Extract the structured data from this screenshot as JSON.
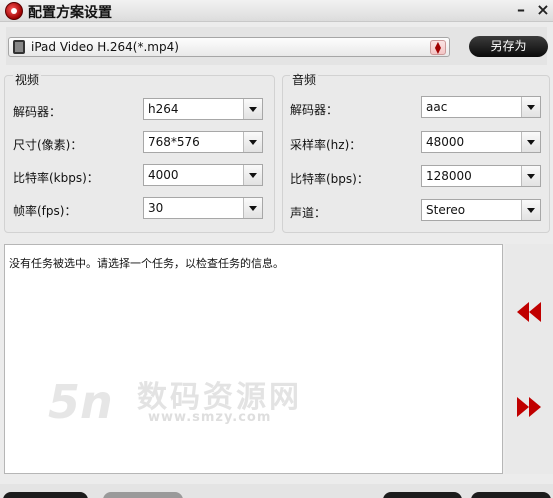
{
  "window": {
    "title": "配置方案设置",
    "minimize_label": "–",
    "close_label": "×"
  },
  "profile": {
    "selected": "iPad Video H.264(*.mp4)",
    "save_as_label": "另存为"
  },
  "video": {
    "group_title": "视频",
    "fields": [
      {
        "label": "解码器：",
        "value": "h264"
      },
      {
        "label": "尺寸(像素)：",
        "value": "768*576"
      },
      {
        "label": "比特率(kbps)：",
        "value": "4000"
      },
      {
        "label": "帧率(fps)：",
        "value": "30"
      }
    ]
  },
  "audio": {
    "group_title": "音频",
    "fields": [
      {
        "label": "解码器：",
        "value": "aac"
      },
      {
        "label": "采样率(hz)：",
        "value": "48000"
      },
      {
        "label": "比特率(bps)：",
        "value": "128000"
      },
      {
        "label": "声道：",
        "value": "Stereo"
      }
    ]
  },
  "info": {
    "message": "没有任务被选中。请选择一个任务，以检查任务的信息。"
  },
  "watermark": {
    "logo": "5n",
    "text": "数码资源网",
    "url": "www.smzy.com"
  },
  "colors": {
    "accent": "#c00000",
    "save_button_bg": "#1a1a1a"
  }
}
